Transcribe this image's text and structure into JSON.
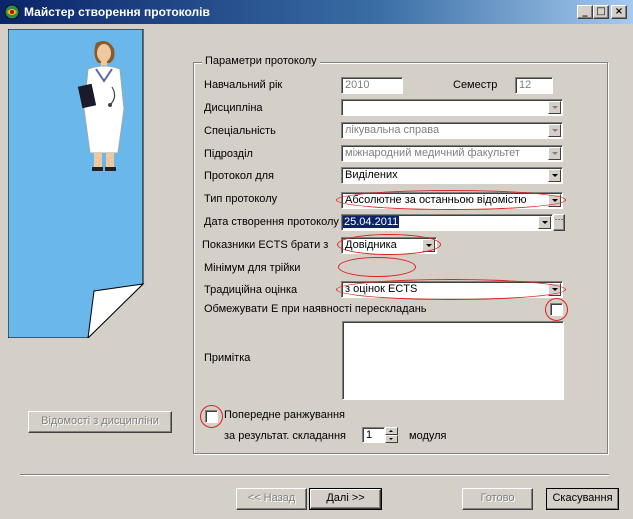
{
  "window": {
    "title": "Майстер створення протоколів",
    "minimize_glyph": "_",
    "maximize_glyph": "□",
    "close_glyph": "×"
  },
  "group_title": "Параметри протоколу",
  "fields": {
    "year_label": "Навчальний рік",
    "year_value": "2010",
    "semester_label": "Семестр",
    "semester_value": "12",
    "discipline_label": "Дисципліна",
    "discipline_value": "",
    "specialty_label": "Спеціальність",
    "specialty_value": "лікувальна справа",
    "department_label": "Підрозділ",
    "department_value": "міжнародний медичний факультет",
    "protocol_for_label": "Протокол для",
    "protocol_for_value": "Виділених",
    "protocol_type_label": "Тип протоколу",
    "protocol_type_value": "Абсолютне за останньою відомістю",
    "date_label": "Дата створення протоколу",
    "date_value": "25.04.2011",
    "ects_label": "Показники ECTS брати з",
    "ects_value": "Довідника",
    "min_three_label": "Мінімум для трійки",
    "min_three_value": "",
    "traditional_label": "Традиційна оцінка",
    "traditional_value": "з оцінок ECTS",
    "limit_e_label": "Обмежувати E при наявності перескладань",
    "note_label": "Примітка",
    "note_value": "",
    "ranking_label": "Попередне ранжування",
    "ranking_by_label": "за результат. складання",
    "ranking_count": "1",
    "ranking_module_label": "модуля"
  },
  "buttons": {
    "discipline_statements": "Відомості з дисципліни",
    "back": "<< Назад",
    "next": "Далі >>",
    "finish": "Готово",
    "cancel": "Скасування"
  },
  "colors": {
    "illustration_bg": "#6ab7ec",
    "selection": "#0a246a",
    "annotation": "#e02020"
  }
}
